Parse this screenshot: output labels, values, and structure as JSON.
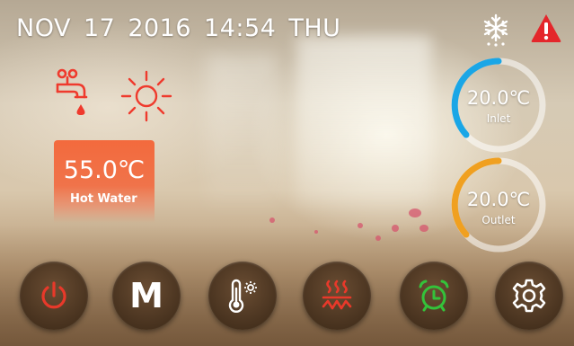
{
  "header": {
    "month": "NOV",
    "day": "17",
    "year": "2016",
    "time": "14:54",
    "weekday": "THU"
  },
  "status_icons": [
    "defrost-icon",
    "alarm-warning-icon"
  ],
  "mode_icons": [
    "water-tap-icon",
    "sun-icon"
  ],
  "hot_water": {
    "temperature": "55.0℃",
    "label": "Hot Water"
  },
  "inlet": {
    "temperature": "20.0℃",
    "label": "Inlet",
    "ring_color": "#1aa6e6"
  },
  "outlet": {
    "temperature": "20.0℃",
    "label": "Outlet",
    "ring_color": "#f0a020"
  },
  "buttons": [
    {
      "icon": "power-icon",
      "color": "#e8392a"
    },
    {
      "label": "M",
      "icon": "mode-icon",
      "color": "#ffffff"
    },
    {
      "icon": "thermometer-settings-icon",
      "color": "#ffffff"
    },
    {
      "icon": "heating-icon",
      "color": "#e8392a"
    },
    {
      "icon": "alarm-clock-icon",
      "color": "#34c23a"
    },
    {
      "icon": "settings-gear-icon",
      "color": "#ffffff"
    }
  ],
  "colors": {
    "hot_card": "#f36a3d",
    "accent_red": "#e8392a",
    "accent_green": "#34c23a"
  }
}
